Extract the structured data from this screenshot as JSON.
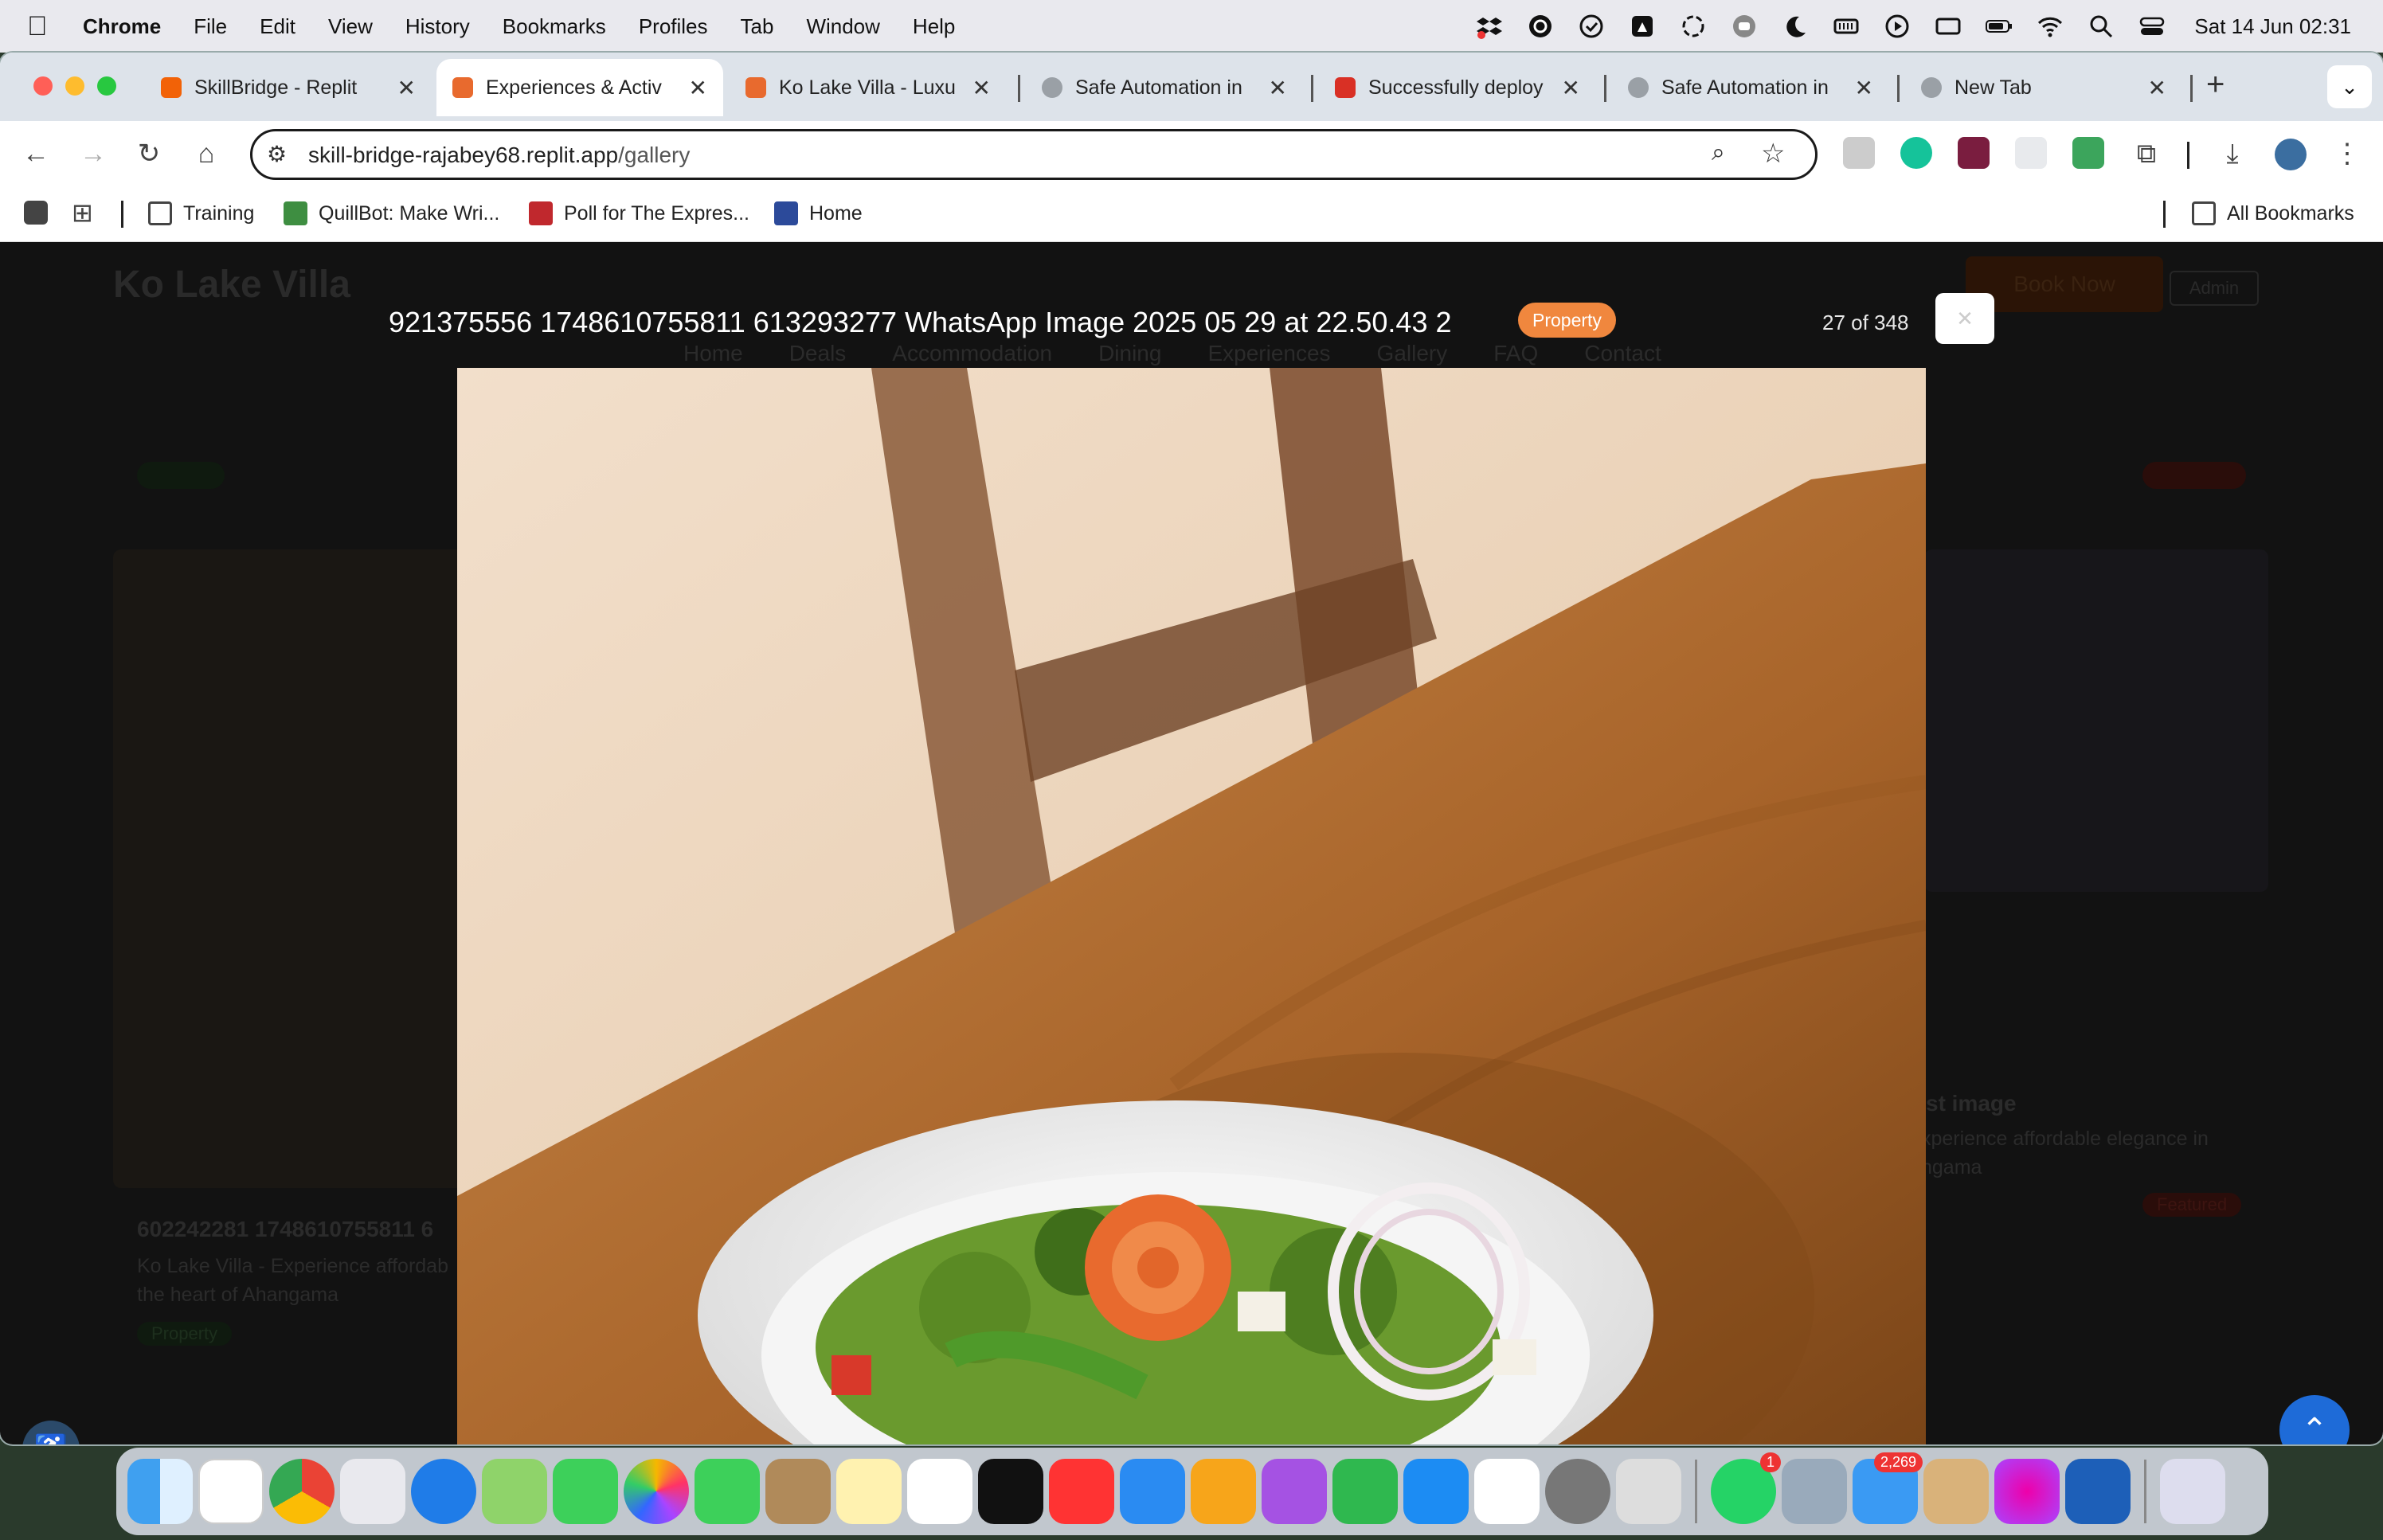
{
  "menubar": {
    "app": "Chrome",
    "items": [
      "File",
      "Edit",
      "View",
      "History",
      "Bookmarks",
      "Profiles",
      "Tab",
      "Window",
      "Help"
    ],
    "clock": "Sat 14 Jun  02:31"
  },
  "tabs": [
    {
      "title": "SkillBridge - Replit",
      "color": "#f26207"
    },
    {
      "title": "Experiences & Activ",
      "color": "#e86a2e"
    },
    {
      "title": "Ko Lake Villa - Luxu",
      "color": "#e86a2e"
    },
    {
      "title": "Safe Automation in ",
      "color": "#9aa0a6"
    },
    {
      "title": "Successfully deploy",
      "color": "#d93025"
    },
    {
      "title": "Safe Automation in ",
      "color": "#9aa0a6"
    },
    {
      "title": "New Tab",
      "color": "#9aa0a6"
    }
  ],
  "omnibox": {
    "host": "skill-bridge-rajabey68.replit.app",
    "path": "/gallery"
  },
  "bookmarks": {
    "items": [
      {
        "label": "Training",
        "icon": "folder-icon"
      },
      {
        "label": "QuillBot: Make Wri...",
        "icon": "quillbot-icon"
      },
      {
        "label": "Poll for The Expres...",
        "icon": "b-icon"
      },
      {
        "label": "Home",
        "icon": "th-icon"
      }
    ],
    "all": "All Bookmarks"
  },
  "background_page": {
    "site_title": "Ko Lake Villa",
    "nav": [
      "Home",
      "Deals",
      "Accommodation",
      "Dining",
      "Experiences",
      "Gallery",
      "FAQ",
      "Contact"
    ],
    "book_now": "Book Now",
    "admin": "Admin",
    "card_title": "602242281 1748610755811 6",
    "card_desc": "Ko Lake Villa - Experience affordab",
    "card_desc2": "the heart of Ahangama",
    "card_tag": "Property",
    "right_title": "st image",
    "right_desc": "xperience affordable elegance in",
    "right_desc2": "ngama",
    "featured": "Featured"
  },
  "lightbox": {
    "title": "921375556 1748610755811 613293277 WhatsApp Image 2025 05 29 at 22.50.43 2",
    "badge": "Property",
    "counter": "27 of 348"
  },
  "dock": {
    "badges": {
      "whatsapp": "1",
      "mail": "2,269"
    },
    "apps": [
      "finder",
      "chatgpt",
      "chrome",
      "launchpad",
      "safari",
      "maps",
      "messages",
      "photos",
      "facetime",
      "contacts",
      "notes",
      "reminders",
      "tv",
      "news",
      "keynote",
      "pages",
      "podcasts",
      "numbers",
      "app-store",
      "freeform",
      "system-settings",
      "iphone-mirroring",
      "whatsapp",
      "preview",
      "mail",
      "archive",
      "flower",
      "word",
      "trash"
    ]
  },
  "colors": {
    "accent": "#f0873e",
    "scroll_top": "#1e6bd8"
  }
}
